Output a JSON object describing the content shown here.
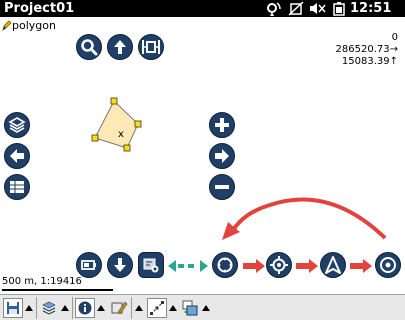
{
  "statusbar": {
    "title": "Project01",
    "time": "12:51",
    "icons": [
      "gps-signal-icon",
      "no-connection-icon",
      "speaker-muted-icon",
      "battery-icon"
    ]
  },
  "map": {
    "layer_name": "polygon",
    "readout": {
      "line1": "0",
      "line2": "286520.73→",
      "line3": "15083.39↑"
    },
    "scale_text": "500 m, 1:19416",
    "feature": {
      "label": "x",
      "fill": "#fde9b5",
      "vertex_color": "#ffe000"
    }
  },
  "colors": {
    "button": "#1f3f66",
    "accent_red": "#e0443d",
    "accent_teal": "#2aa58f"
  },
  "buttons": {
    "top": [
      "zoom-icon",
      "north-up-icon",
      "zoom-extent-icon"
    ],
    "left": [
      "layers-icon",
      "pan-left-icon",
      "attribute-table-icon"
    ],
    "right": [
      "zoom-in-icon",
      "pan-right-icon",
      "zoom-out-icon"
    ],
    "bottom": [
      "battery-mode-icon",
      "download-icon",
      "map-settings-icon",
      "target-icon",
      "gps-position-icon",
      "navigation-arrow-icon",
      "center-point-icon"
    ]
  },
  "toolbar": {
    "tools": [
      "save-icon",
      "layers-3d-icon",
      "info-icon",
      "edit-tools-icon",
      "measure-icon",
      "window-switch-icon"
    ]
  }
}
